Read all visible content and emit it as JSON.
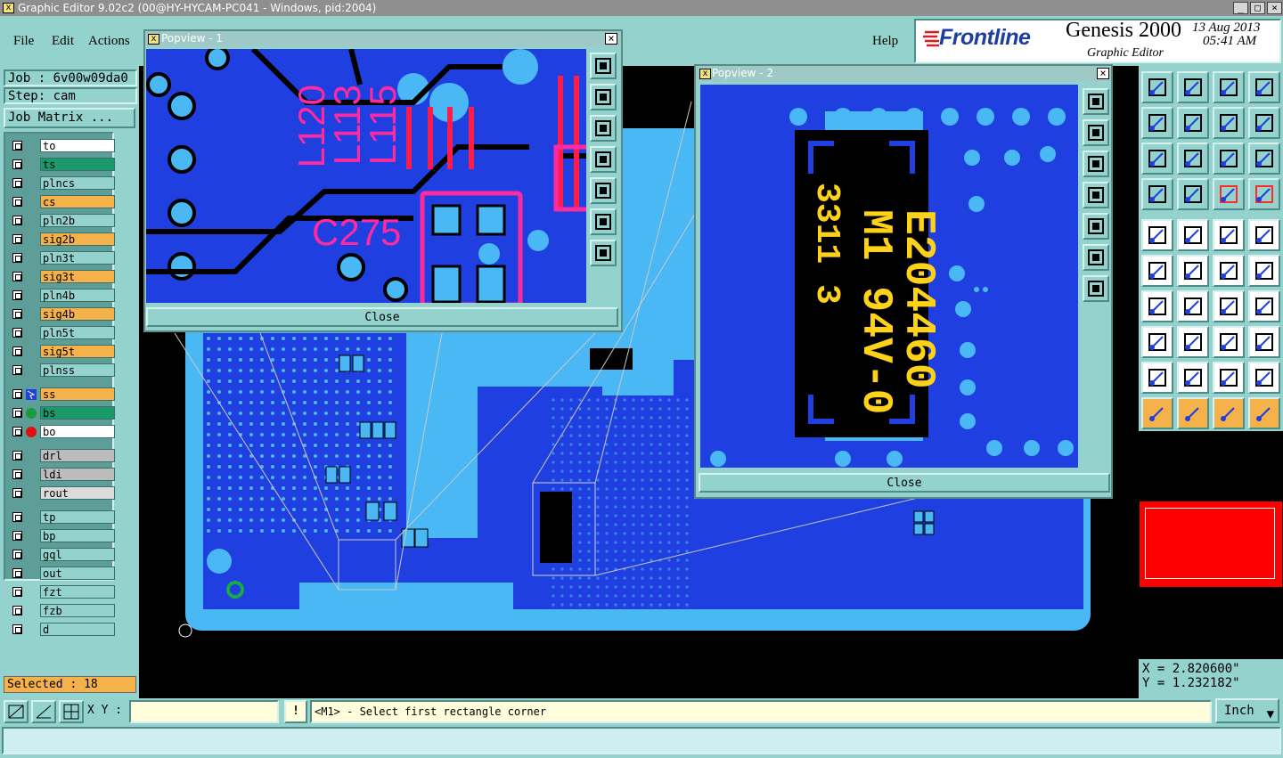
{
  "window": {
    "title": "Graphic Editor 9.02c2 (00@HY-HYCAM-PC041 - Windows, pid:2004)"
  },
  "menu": {
    "file": "File",
    "edit": "Edit",
    "actions": "Actions",
    "help": "Help"
  },
  "brand": {
    "logo": "Frontline",
    "product": "Genesis 2000",
    "subtitle": "Graphic Editor",
    "date": "13 Aug 2013",
    "time": "05:41 AM"
  },
  "job": {
    "job_label": "Job : 6v00w09da0",
    "step_label": "Step: cam",
    "matrix_button": "Job Matrix ..."
  },
  "layers": [
    {
      "name": "to",
      "color": "#ffffff"
    },
    {
      "name": "ts",
      "color": "#1a9a6a"
    },
    {
      "name": "plncs",
      "color": "#93d2cd"
    },
    {
      "name": "cs",
      "color": "#f5b24a"
    },
    {
      "name": "pln2b",
      "color": "#93d2cd"
    },
    {
      "name": "sig2b",
      "color": "#f5b24a"
    },
    {
      "name": "pln3t",
      "color": "#93d2cd"
    },
    {
      "name": "sig3t",
      "color": "#f5b24a"
    },
    {
      "name": "pln4b",
      "color": "#93d2cd"
    },
    {
      "name": "sig4b",
      "color": "#f5b24a"
    },
    {
      "name": "pln5t",
      "color": "#93d2cd"
    },
    {
      "name": "sig5t",
      "color": "#f5b24a"
    },
    {
      "name": "plnss",
      "color": "#93d2cd"
    },
    {
      "name": "ss",
      "color": "#f5b24a"
    },
    {
      "name": "bs",
      "color": "#1a9a6a"
    },
    {
      "name": "bo",
      "color": "#ffffff"
    },
    {
      "name": "drl",
      "color": "#bcbcbc"
    },
    {
      "name": "ldi",
      "color": "#bcbcbc"
    },
    {
      "name": "rout",
      "color": "#dcdcdc"
    },
    {
      "name": "tp",
      "color": "#93d2cd"
    },
    {
      "name": "bp",
      "color": "#93d2cd"
    },
    {
      "name": "gql",
      "color": "#93d2cd"
    },
    {
      "name": "out",
      "color": "#93d2cd"
    },
    {
      "name": "fzt",
      "color": "#93d2cd"
    },
    {
      "name": "fzb",
      "color": "#93d2cd"
    },
    {
      "name": "d",
      "color": "#93d2cd"
    }
  ],
  "selected": "Selected : 18",
  "popview1": {
    "title": "Popview - 1",
    "close": "Close",
    "labels": [
      "L120",
      "L113",
      "L115",
      "C275"
    ]
  },
  "popview2": {
    "title": "Popview - 2",
    "close": "Close",
    "marking": [
      "E204460",
      "M1 94V-0",
      "3311 3"
    ]
  },
  "coords": {
    "x": "X = 2.820600\"",
    "y": "Y = 1.232182\""
  },
  "status": {
    "xy_label": "X Y :",
    "xy_value": "",
    "message": "<M1> - Select first rectangle corner",
    "units": "Inch"
  },
  "tools": [
    "zoom-home",
    "zoom-in",
    "zoom-out",
    "zoom-fit",
    "pan-left",
    "pan-right",
    "flip",
    "mirror",
    "zoom-area",
    "pan-center",
    "scale-1-2",
    "help",
    "measure",
    "grid",
    "snap-a",
    "snap-b",
    "add-pad",
    "add-line",
    "ruler",
    "add-circle",
    "route-net",
    "net-cross",
    "connect",
    "route-pads",
    "angle",
    "line-tool",
    "arc",
    "text-tool",
    "select-net",
    "cut",
    "net-area",
    "group",
    "drc-a",
    "drc-b",
    "drc-c",
    "drc-d",
    "pointer",
    "select-arrow",
    "select-single",
    "select-net-tool"
  ],
  "colors": {
    "board": "#1f3fe0",
    "copper_light": "#49b8f5",
    "trace": "#000000",
    "silk": "#ff2aa0",
    "marking": "#ffd21a",
    "highlight": "#ff0000"
  }
}
